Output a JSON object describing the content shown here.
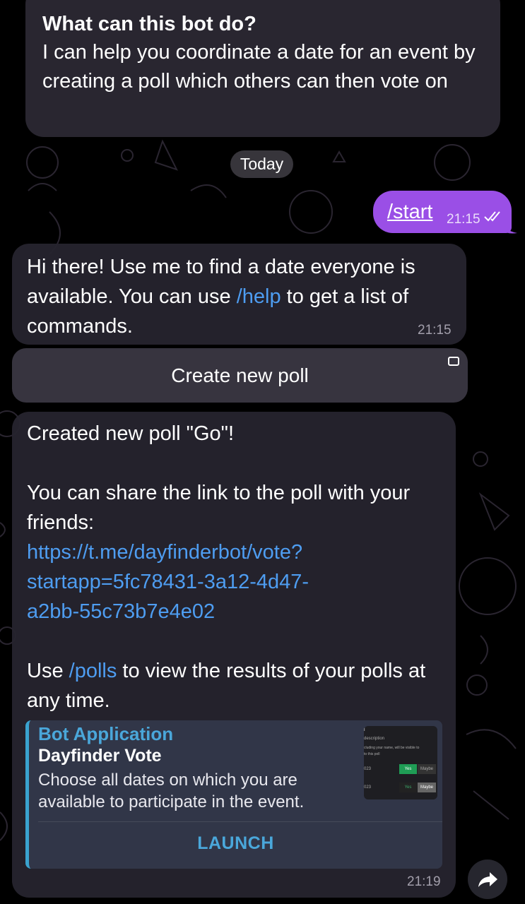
{
  "intro": {
    "title": "What can this bot do?",
    "body": "I can help you coordinate a date for an event by creating a poll which others can then vote on"
  },
  "date_separator": "Today",
  "outgoing_message": {
    "text": "/start",
    "time": "21:15"
  },
  "message_1": {
    "text_before": "Hi there! Use me to find a date everyone is available. You can use ",
    "link": "/help",
    "text_after": " to get a list of commands.",
    "time": "21:15"
  },
  "keyboard_button": {
    "label": "Create new poll"
  },
  "message_2": {
    "line1": "Created new poll \"Go\"!",
    "line2": "You can share the link to the poll with your friends:",
    "url": "https://t.me/dayfinderbot/vote?startapp=5fc78431-3a12-4d47-a2bb-55c73b7e4e02",
    "url_line1": "https://t.me/dayfinderbot/vote?",
    "url_line2": "startapp=5fc78431-3a12-4d47-",
    "url_line3": "a2bb-55c73b7e4e02",
    "use_prefix": "Use ",
    "use_link": "/polls",
    "use_suffix": " to view the results of your polls at any time.",
    "time": "21:19",
    "preview": {
      "site_name": "Bot Application",
      "title": "Dayfinder Vote",
      "description": "Choose all dates on which you are available to participate in the event.",
      "action": "LAUNCH",
      "thumb": {
        "line_a": "l",
        "line_b": "description",
        "line_c": "cluding your name, will be visible to",
        "line_d": "to this poll",
        "row1_date": "023",
        "row1_yes": "Yes",
        "row1_maybe": "Maybe",
        "row2_date": "023",
        "row2_yes": "Yes",
        "row2_maybe": "Maybe"
      }
    }
  },
  "colors": {
    "outgoing_bubble": "#9a4fe6",
    "link": "#4e9df1",
    "preview_accent": "#3aa3cf"
  }
}
